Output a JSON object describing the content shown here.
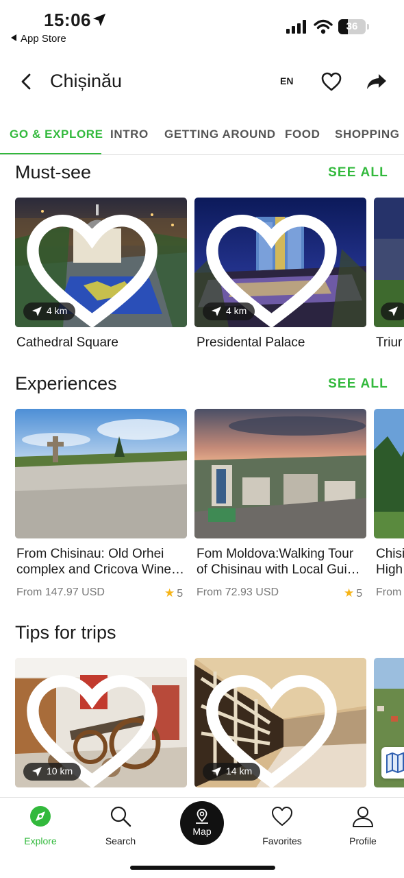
{
  "status_bar": {
    "time": "15:06",
    "back_app": "App Store",
    "battery_percent": "36",
    "battery_level": 0.36
  },
  "header": {
    "title": "Chișinău",
    "language": "EN"
  },
  "tabs": [
    {
      "label": "GO & EXPLORE",
      "active": true
    },
    {
      "label": "INTRO"
    },
    {
      "label": "GETTING AROUND"
    },
    {
      "label": "FOOD"
    },
    {
      "label": "SHOPPING"
    }
  ],
  "must_see": {
    "title": "Must-see",
    "see_all": "SEE ALL",
    "cards": [
      {
        "name": "Cathedral Square",
        "distance": "4 km"
      },
      {
        "name": "Presidental Palace",
        "distance": "4 km"
      },
      {
        "name": "Triur"
      }
    ]
  },
  "experiences": {
    "title": "Experiences",
    "see_all": "SEE ALL",
    "cards": [
      {
        "name": "From Chisinau: Old Orhei complex and Cricova Wine…",
        "price": "From 147.97 USD",
        "rating": "5"
      },
      {
        "name": "Fom Moldova:Walking Tour of Chisinau with Local Gui…",
        "price": "From 72.93 USD",
        "rating": "5"
      },
      {
        "name": "Chisi High",
        "price": "From"
      }
    ]
  },
  "tips": {
    "title": "Tips for trips",
    "cards": [
      {
        "distance": "10 km"
      },
      {
        "distance": "14 km"
      }
    ]
  },
  "bottom_nav": {
    "items": [
      {
        "label": "Explore",
        "icon": "compass-icon",
        "active": true
      },
      {
        "label": "Search",
        "icon": "search-icon"
      },
      {
        "label": "Map",
        "icon": "map-pin-icon"
      },
      {
        "label": "Favorites",
        "icon": "heart-icon"
      },
      {
        "label": "Profile",
        "icon": "person-icon"
      }
    ]
  },
  "colors": {
    "accent": "#32b93c",
    "rating_star": "#f6b417",
    "text": "#1a1a1a"
  }
}
